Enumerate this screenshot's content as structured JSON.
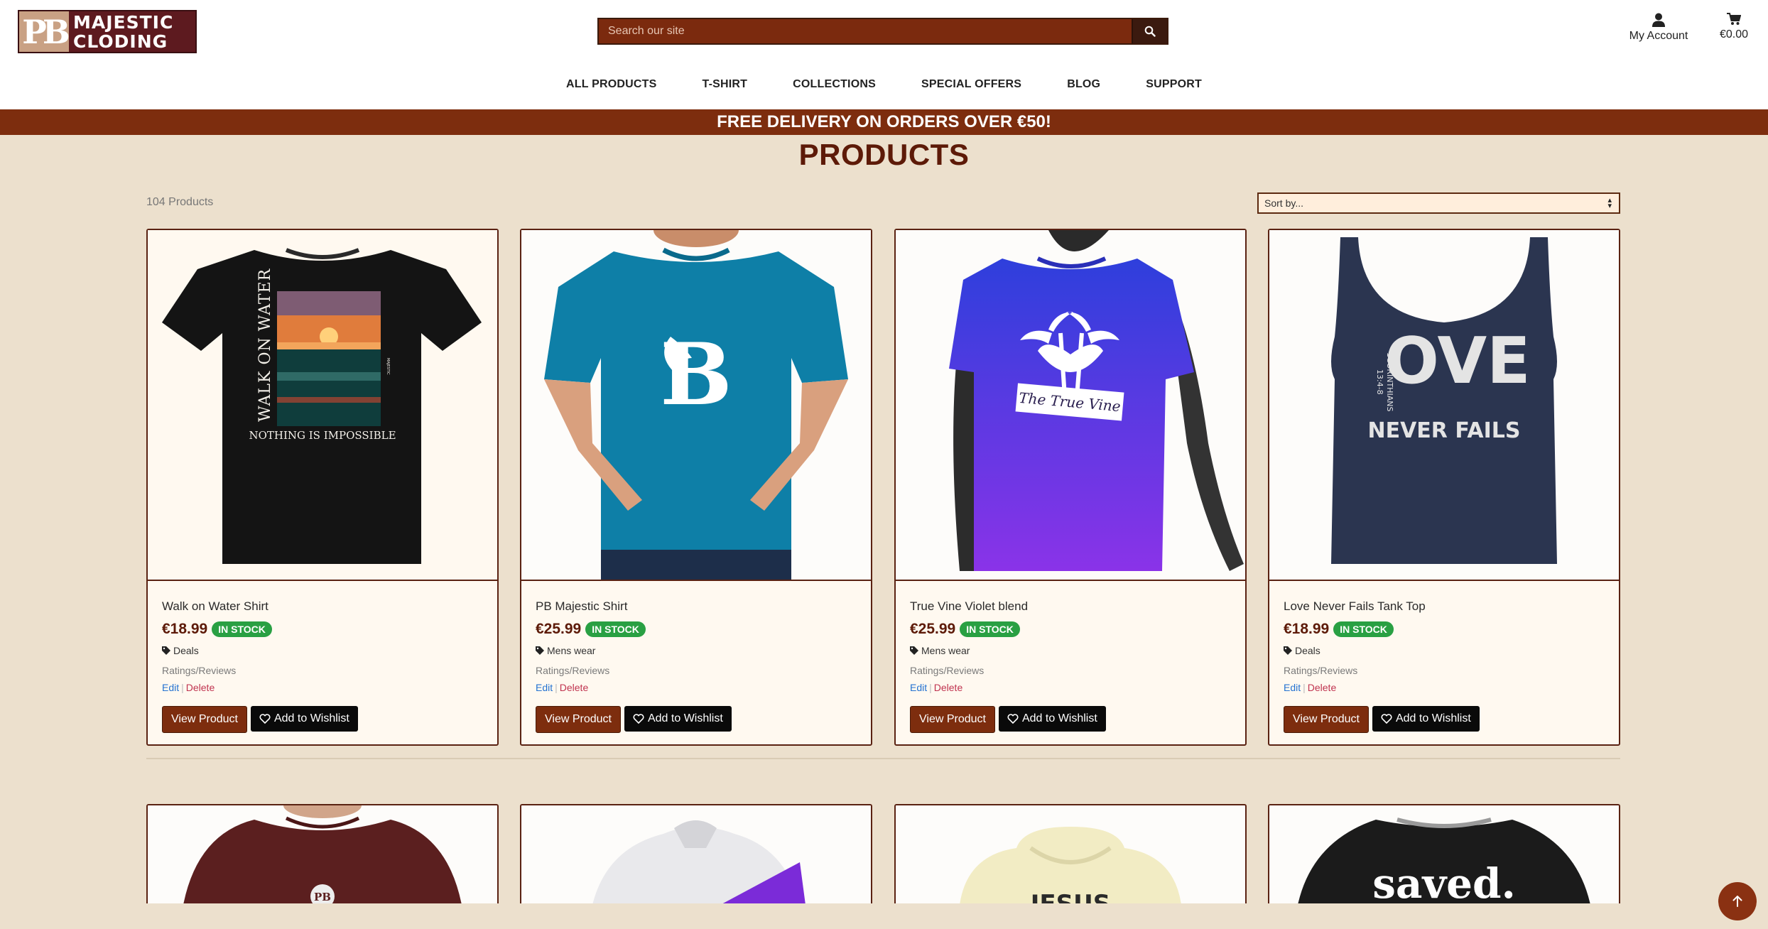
{
  "brand": {
    "logo_initials": "PB",
    "line1": "MAJESTIC",
    "line2": "CLODING"
  },
  "search": {
    "placeholder": "Search our site"
  },
  "account": {
    "label": "My Account"
  },
  "cart": {
    "total": "€0.00"
  },
  "nav": [
    "ALL PRODUCTS",
    "T-SHIRT",
    "COLLECTIONS",
    "SPECIAL OFFERS",
    "BLOG",
    "SUPPORT"
  ],
  "promo": "FREE DELIVERY ON ORDERS OVER €50!",
  "page_title": "PRODUCTS",
  "product_count": "104 Products",
  "sort": {
    "selected": "Sort by..."
  },
  "labels": {
    "ratings": "Ratings/Reviews",
    "edit": "Edit",
    "sep": "|",
    "delete": "Delete",
    "view": "View Product",
    "wishlist": "Add to Wishlist",
    "stock": "IN STOCK"
  },
  "products": [
    {
      "name": "Walk on Water Shirt",
      "price": "€18.99",
      "category": "Deals",
      "art": {
        "side": "WALK ON WATER",
        "bottom": "NOTHING IS IMPOSSIBLE",
        "tag": "MAJESTIC"
      }
    },
    {
      "name": "PB Majestic Shirt",
      "price": "€25.99",
      "category": "Mens wear",
      "art": {
        "mark": "B"
      }
    },
    {
      "name": "True Vine Violet blend",
      "price": "€25.99",
      "category": "Mens wear",
      "art": {
        "label": "The True Vine"
      }
    },
    {
      "name": "Love Never Fails Tank Top",
      "price": "€18.99",
      "category": "Deals",
      "art": {
        "big": "OVE",
        "line2": "NEVER FAILS",
        "side1": "1CORINTHIANS",
        "side2": "13:4-8"
      }
    }
  ],
  "row2_art": {
    "mark": "PB",
    "hoodie": "JESUS",
    "shirt": "saved."
  },
  "colors": {
    "brand_brown": "#7d2d0e",
    "page_bg": "#ece0cd",
    "stock_green": "#29a043"
  }
}
